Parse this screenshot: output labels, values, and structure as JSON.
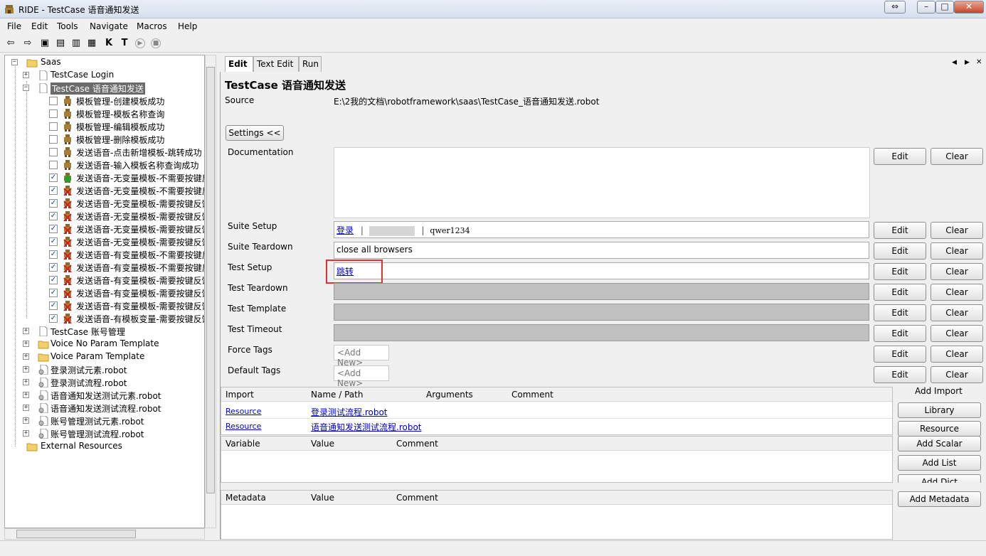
{
  "app": {
    "title": "RIDE - TestCase 语音通知发送"
  },
  "window_buttons": {
    "restore": "⇔",
    "minimize": "–",
    "maximize": "□",
    "close": "✕"
  },
  "menu": [
    "File",
    "Edit",
    "Tools",
    "Navigate",
    "Macros",
    "Help"
  ],
  "toolbar": [
    {
      "icon": "back-arrow-icon",
      "glyph": "⇦"
    },
    {
      "icon": "forward-arrow-icon",
      "glyph": "⇨"
    },
    {
      "icon": "open-directory-icon",
      "glyph": "▣"
    },
    {
      "icon": "open-folder-icon",
      "glyph": "▤"
    },
    {
      "icon": "save-icon",
      "glyph": "▥"
    },
    {
      "icon": "save-all-icon",
      "glyph": "▦"
    },
    {
      "icon": "search-keywords-icon",
      "glyph": "K"
    },
    {
      "icon": "search-tests-icon",
      "glyph": "T"
    },
    {
      "icon": "run-icon",
      "glyph": "▶"
    },
    {
      "icon": "stop-icon",
      "glyph": "■"
    }
  ],
  "tree": {
    "root": "Saas",
    "items": [
      {
        "label": "TestCase Login",
        "type": "file",
        "expander": "+",
        "level": 1
      },
      {
        "label": "TestCase 语音通知发送",
        "type": "file",
        "expander": "−",
        "level": 1,
        "selected": true
      },
      {
        "label": "模板管理-创建模板成功",
        "type": "test",
        "checked": false,
        "status": "none",
        "level": 2
      },
      {
        "label": "模板管理-模板名称查询",
        "type": "test",
        "checked": false,
        "status": "none",
        "level": 2
      },
      {
        "label": "模板管理-编辑模板成功",
        "type": "test",
        "checked": false,
        "status": "none",
        "level": 2
      },
      {
        "label": "模板管理-删除模板成功",
        "type": "test",
        "checked": false,
        "status": "none",
        "level": 2
      },
      {
        "label": "发送语音-点击新增模板-跳转成功",
        "type": "test",
        "checked": false,
        "status": "none",
        "level": 2
      },
      {
        "label": "发送语音-输入模板名称查询成功",
        "type": "test",
        "checked": false,
        "status": "none",
        "level": 2
      },
      {
        "label": "发送语音-无变量模板-不需要按键反",
        "type": "test",
        "checked": true,
        "status": "pass",
        "level": 2
      },
      {
        "label": "发送语音-无变量模板-不需要按键反",
        "type": "test",
        "checked": true,
        "status": "fail",
        "level": 2
      },
      {
        "label": "发送语音-无变量模板-需要按键反馈",
        "type": "test",
        "checked": true,
        "status": "fail",
        "level": 2
      },
      {
        "label": "发送语音-无变量模板-需要按键反馈",
        "type": "test",
        "checked": true,
        "status": "fail",
        "level": 2
      },
      {
        "label": "发送语音-无变量模板-需要按键反馈",
        "type": "test",
        "checked": true,
        "status": "fail",
        "level": 2
      },
      {
        "label": "发送语音-无变量模板-需要按键反馈",
        "type": "test",
        "checked": true,
        "status": "fail",
        "level": 2
      },
      {
        "label": "发送语音-有变量模板-不需要按键反",
        "type": "test",
        "checked": true,
        "status": "fail",
        "level": 2
      },
      {
        "label": "发送语音-有变量模板-不需要按键反",
        "type": "test",
        "checked": true,
        "status": "fail",
        "level": 2
      },
      {
        "label": "发送语音-有变量模板-需要按键反馈",
        "type": "test",
        "checked": true,
        "status": "fail",
        "level": 2
      },
      {
        "label": "发送语音-有变量模板-需要按键反馈",
        "type": "test",
        "checked": true,
        "status": "fail",
        "level": 2
      },
      {
        "label": "发送语音-有变量模板-需要按键反馈",
        "type": "test",
        "checked": true,
        "status": "fail",
        "level": 2
      },
      {
        "label": "发送语音-有模板变量-需要按键反馈",
        "type": "test",
        "checked": true,
        "status": "fail",
        "level": 2
      },
      {
        "label": "TestCase 账号管理",
        "type": "file",
        "expander": "+",
        "level": 1
      },
      {
        "label": "Voice No Param Template",
        "type": "folder",
        "expander": "+",
        "level": 1
      },
      {
        "label": "Voice Param Template",
        "type": "folder",
        "expander": "+",
        "level": 1
      },
      {
        "label": "登录测试元素.robot",
        "type": "resource",
        "expander": "+",
        "level": 1
      },
      {
        "label": "登录测试流程.robot",
        "type": "resource",
        "expander": "+",
        "level": 1
      },
      {
        "label": "语音通知发送测试元素.robot",
        "type": "resource",
        "expander": "+",
        "level": 1
      },
      {
        "label": "语音通知发送测试流程.robot",
        "type": "resource",
        "expander": "+",
        "level": 1
      },
      {
        "label": "账号管理测试元素.robot",
        "type": "resource",
        "expander": "+",
        "level": 1
      },
      {
        "label": "账号管理测试流程.robot",
        "type": "resource",
        "expander": "+",
        "level": 1
      }
    ],
    "external": "External Resources"
  },
  "tabs": [
    {
      "label": "Edit",
      "active": true
    },
    {
      "label": "Text Edit",
      "active": false
    },
    {
      "label": "Run",
      "active": false
    }
  ],
  "nav_arrows": {
    "left": "◀",
    "right": "▶",
    "close": "✕"
  },
  "editor": {
    "heading": "TestCase 语音通知发送",
    "source_label": "Source",
    "source_path": "E:\\2我的文档\\robotframework\\saas\\TestCase_语音通知发送.robot",
    "settings_button": "Settings <<",
    "edit_label": "Edit",
    "clear_label": "Clear",
    "documentation_label": "Documentation",
    "suite_setup": {
      "label": "Suite Setup",
      "keyword": "登录",
      "sep1": "|",
      "masked": "",
      "sep2": "|",
      "arg": "qwer1234"
    },
    "suite_teardown": {
      "label": "Suite Teardown",
      "value": "close all browsers"
    },
    "test_setup": {
      "label": "Test Setup",
      "keyword": "跳转"
    },
    "test_teardown": {
      "label": "Test Teardown"
    },
    "test_template": {
      "label": "Test Template"
    },
    "test_timeout": {
      "label": "Test Timeout"
    },
    "force_tags": {
      "label": "Force Tags",
      "placeholder": "<Add New>"
    },
    "default_tags": {
      "label": "Default Tags",
      "placeholder": "<Add New>"
    }
  },
  "import_table": {
    "headers": [
      "Import",
      "Name / Path",
      "Arguments",
      "Comment"
    ],
    "rows": [
      {
        "type": "Resource",
        "name": "登录测试流程.robot"
      },
      {
        "type": "Resource",
        "name": "语音通知发送测试流程.robot"
      }
    ]
  },
  "variable_table": {
    "headers": [
      "Variable",
      "Value",
      "Comment"
    ]
  },
  "metadata_table": {
    "headers": [
      "Metadata",
      "Value",
      "Comment"
    ]
  },
  "side_buttons": {
    "add_import": "Add Import",
    "library": "Library",
    "resource": "Resource",
    "add_scalar": "Add Scalar",
    "add_list": "Add List",
    "add_dict": "Add Dict",
    "add_metadata": "Add Metadata"
  },
  "colors": {
    "highlight_box": "#e03030",
    "link": "#0000cc",
    "selected_bg": "#6b6b6b"
  }
}
